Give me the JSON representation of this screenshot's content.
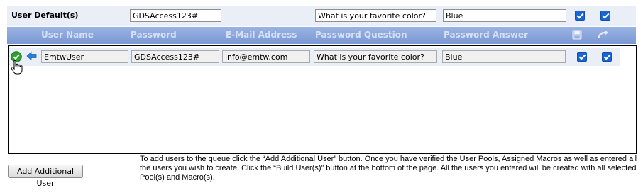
{
  "defaults": {
    "label": "User Default(s)",
    "password": "GDSAccess123#",
    "question": "What is your favorite color?",
    "answer": "Blue",
    "checkbox1_checked": true,
    "checkbox2_checked": true
  },
  "header": {
    "columns": [
      "User Name",
      "Password",
      "E-Mail Address",
      "Password Question",
      "Password Answer"
    ],
    "icons": [
      "save-icon",
      "redo-icon"
    ]
  },
  "rows": [
    {
      "username": "EmtwUser",
      "password": "GDSAccess123#",
      "email": "info@emtw.com",
      "question": "What is your favorite color?",
      "answer": "Blue",
      "checkbox1_checked": true,
      "checkbox2_checked": true
    }
  ],
  "footer": {
    "button_label": "Add Additional User",
    "info_text": "To add users to the queue click the “Add Additional User” button. Once you have verified the User Pools, Assigned Macros as well as entered all the users you wish to create. Click the “Build User(s)” button at the bottom of the page. All the users you entered will be created with all selected Pool(s) and Macro(s)."
  },
  "colors": {
    "header_bar": "#7f9dd6",
    "header_text": "#d5e0f5",
    "row_bg": "#e9eef7",
    "checkbox": "#1965d3",
    "confirm_icon": "#2e9e2e",
    "arrow_icon": "#2c7fd9"
  }
}
